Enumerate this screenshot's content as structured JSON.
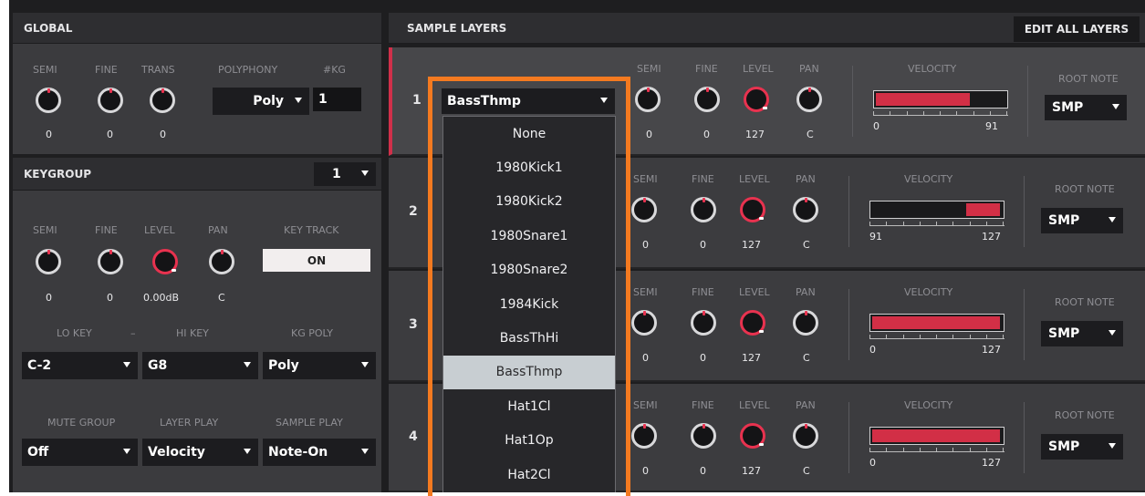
{
  "global": {
    "title": "GLOBAL",
    "labels": {
      "semi": "SEMI",
      "fine": "FINE",
      "trans": "TRANS",
      "polyphony": "POLYPHONY",
      "kg": "#KG"
    },
    "values": {
      "semi": "0",
      "fine": "0",
      "trans": "0"
    },
    "polyphony": "Poly",
    "kg_count": "1"
  },
  "keygroup": {
    "title": "KEYGROUP",
    "selected": "1",
    "labels": {
      "semi": "SEMI",
      "fine": "FINE",
      "level": "LEVEL",
      "pan": "PAN",
      "key_track": "KEY TRACK",
      "lo_key": "LO KEY",
      "hi_key": "HI KEY",
      "kg_poly": "KG POLY",
      "mute_group": "MUTE GROUP",
      "layer_play": "LAYER PLAY",
      "sample_play": "SAMPLE PLAY",
      "dash": "–"
    },
    "values": {
      "semi": "0",
      "fine": "0",
      "level": "0.00dB",
      "pan": "C"
    },
    "key_track": "ON",
    "lo_key": "C-2",
    "hi_key": "G8",
    "kg_poly": "Poly",
    "mute_group": "Off",
    "layer_play": "Velocity",
    "sample_play": "Note-On"
  },
  "sample_layers": {
    "title": "SAMPLE LAYERS",
    "edit_all": "EDIT ALL LAYERS",
    "labels": {
      "semi": "SEMI",
      "fine": "FINE",
      "level": "LEVEL",
      "pan": "PAN",
      "velocity": "VELOCITY",
      "root_note": "ROOT NOTE"
    },
    "layers": [
      {
        "num": "1",
        "semi": "0",
        "fine": "0",
        "level": "127",
        "pan": "C",
        "vel_low": "0",
        "vel_high": "91",
        "vel_from": 0,
        "vel_to": 91,
        "root": "SMP",
        "sample": "BassThmp"
      },
      {
        "num": "2",
        "semi": "0",
        "fine": "0",
        "level": "127",
        "pan": "C",
        "vel_low": "91",
        "vel_high": "127",
        "vel_from": 91,
        "vel_to": 127,
        "root": "SMP"
      },
      {
        "num": "3",
        "semi": "0",
        "fine": "0",
        "level": "127",
        "pan": "C",
        "vel_low": "0",
        "vel_high": "127",
        "vel_from": 0,
        "vel_to": 127,
        "root": "SMP"
      },
      {
        "num": "4",
        "semi": "0",
        "fine": "0",
        "level": "127",
        "pan": "C",
        "vel_low": "0",
        "vel_high": "127",
        "vel_from": 0,
        "vel_to": 127,
        "root": "SMP"
      }
    ]
  },
  "sample_menu": {
    "items": [
      "None",
      "1980Kick1",
      "1980Kick2",
      "1980Snare1",
      "1980Snare2",
      "1984Kick",
      "BassThHi",
      "BassThmp",
      "Hat1Cl",
      "Hat1Op",
      "Hat2Cl"
    ],
    "selected": "BassThmp"
  },
  "colors": {
    "accent": "#e8324f",
    "highlight": "#f47a20",
    "panel": "#3b3b3e"
  }
}
